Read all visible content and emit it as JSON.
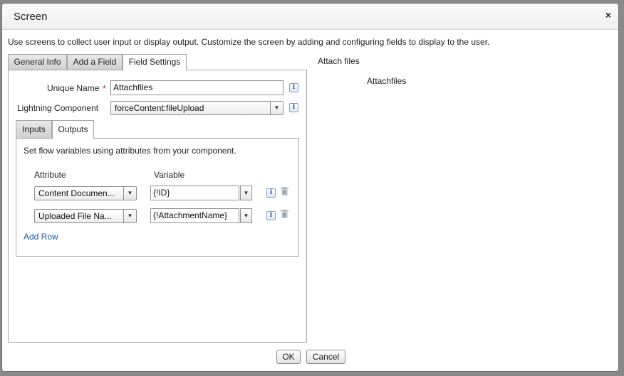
{
  "dialog": {
    "title": "Screen",
    "close_glyph": "×",
    "description": "Use screens to collect user input or display output. Customize the screen by adding and configuring fields to display to the user."
  },
  "tabs": [
    {
      "label": "General Info",
      "active": false
    },
    {
      "label": "Add a Field",
      "active": false
    },
    {
      "label": "Field Settings",
      "active": true
    }
  ],
  "field_settings": {
    "unique_name_label": "Unique Name",
    "required_marker": "*",
    "unique_name_value": "Attachfiles",
    "component_label": "Lightning Component",
    "component_value": "forceContent:fileUpload",
    "info_glyph": "i"
  },
  "sub_tabs": [
    {
      "label": "Inputs",
      "selected": true
    },
    {
      "label": "Outputs",
      "selected": false
    }
  ],
  "outputs": {
    "instructions": "Set flow variables using attributes from your component.",
    "attribute_header": "Attribute",
    "variable_header": "Variable",
    "rows": [
      {
        "attribute": "Content Documen...",
        "variable": "{!ID}"
      },
      {
        "attribute": "Uploaded File Na...",
        "variable": "{!AttachmentName}"
      }
    ],
    "add_row_label": "Add Row"
  },
  "preview": {
    "heading": "Attach files",
    "field_label": "Attachfiles"
  },
  "footer": {
    "ok_label": "OK",
    "cancel_label": "Cancel"
  },
  "icons": [
    "close-icon",
    "info-icon",
    "dropdown-arrow-icon",
    "trash-icon",
    "required-asterisk-icon"
  ],
  "colors": {
    "link": "#1b5aa6",
    "required": "#c23934",
    "info_icon": "#2a5aa8",
    "overlay": "#8a8a8a"
  }
}
